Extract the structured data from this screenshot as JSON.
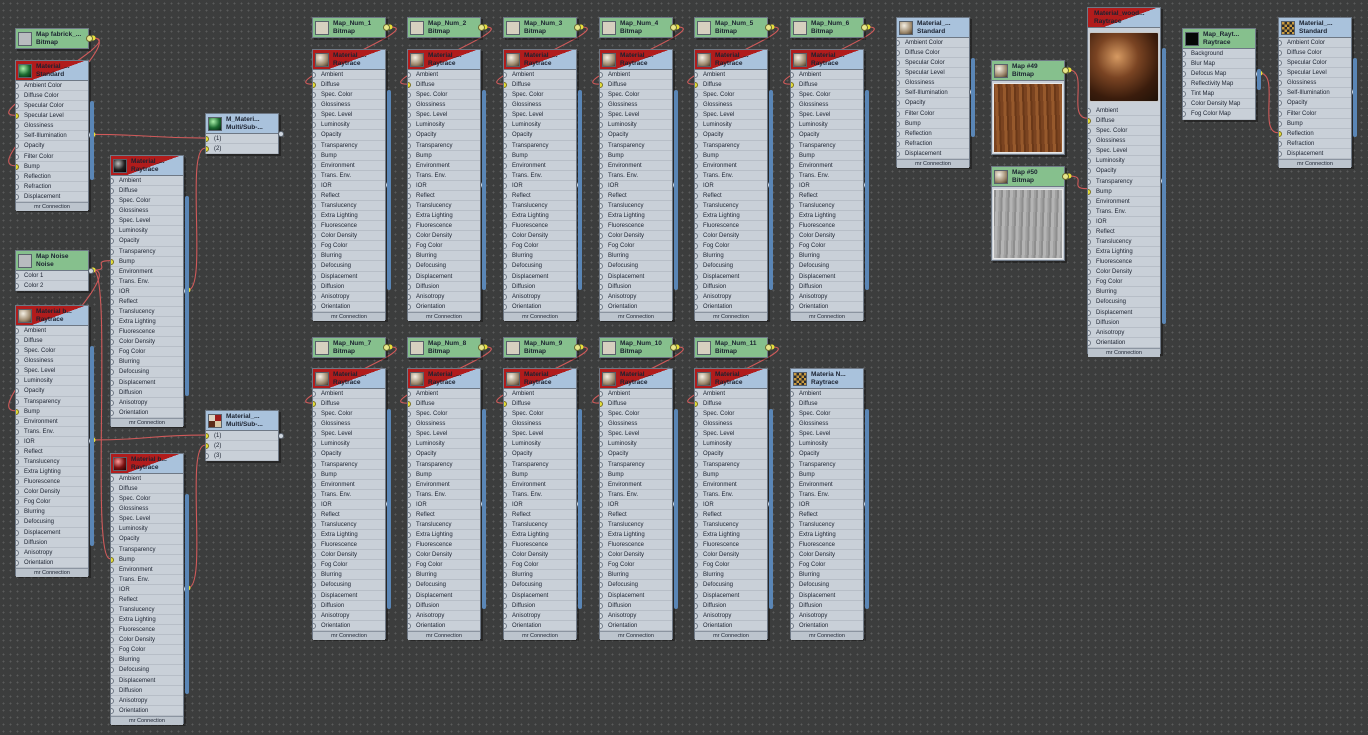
{
  "ui": {
    "footer": "mr Connection"
  },
  "slots_raytrace": [
    "Ambient",
    "Diffuse",
    "Spec. Color",
    "Glossiness",
    "Spec. Level",
    "Luminosity",
    "Opacity",
    "Transparency",
    "Bump",
    "Environment",
    "Trans. Env.",
    "IOR",
    "Reflect",
    "Translucency",
    "Extra Lighting",
    "Fluorescence",
    "Color Density",
    "Fog Color",
    "Blurring",
    "Defocusing",
    "Displacement",
    "Diffusion",
    "Anisotropy",
    "Orientation"
  ],
  "slots_standard": [
    "Ambient Color",
    "Diffuse Color",
    "Specular Color",
    "Specular Level",
    "Glossiness",
    "Self-Illumination",
    "Opacity",
    "Filter Color",
    "Bump",
    "Reflection",
    "Refraction",
    "Displacement"
  ],
  "slots_reflmap": [
    "Background",
    "Blur Map",
    "Defocus Map",
    "Reflectivity Map",
    "Tint Map",
    "Color Density Map",
    "Fog Color Map"
  ],
  "slots_noise": [
    "Color 1",
    "Color 2"
  ],
  "slots_multi2": [
    "(1)",
    "(2)"
  ],
  "slots_multi3": [
    "(1)",
    "(2)",
    "(3)"
  ],
  "nodes": [
    {
      "id": "map_fabrick",
      "title": "Map fabrick_...",
      "subtitle": "Bitmap",
      "kind": "map",
      "thumb": "grey"
    },
    {
      "id": "mat_std_1",
      "title": "Material_...",
      "subtitle": "Standard",
      "kind": "mat",
      "thumb": "green",
      "slots": "standard",
      "selected": true
    },
    {
      "id": "map_noise",
      "title": "Map Noise",
      "subtitle": "Noise",
      "kind": "map",
      "thumb": "grey",
      "slots": "noise"
    },
    {
      "id": "mat_b1",
      "title": "Material b...",
      "subtitle": "Raytrace",
      "kind": "mat",
      "thumb": "sphere",
      "slots": "raytrace",
      "selected": true
    },
    {
      "id": "mat_rt_dark",
      "title": "Material_...",
      "subtitle": "Raytrace",
      "kind": "mat",
      "thumb": "dark",
      "slots": "raytrace",
      "selected": true
    },
    {
      "id": "mat_b2",
      "title": "Material b...",
      "subtitle": "Raytrace",
      "kind": "mat",
      "thumb": "red",
      "slots": "raytrace",
      "selected": true
    },
    {
      "id": "multi_1",
      "title": "M_Materi...",
      "subtitle": "Multi/Sub-...",
      "kind": "mat",
      "thumb": "green",
      "slots": "multi2"
    },
    {
      "id": "multi_2",
      "title": "Material_...",
      "subtitle": "Multi/Sub-...",
      "kind": "mat",
      "thumb": "multi",
      "slots": "multi3"
    },
    {
      "id": "map_num_1",
      "title": "Map_Num_1",
      "subtitle": "Bitmap",
      "kind": "map",
      "thumb": "flat"
    },
    {
      "id": "map_num_2",
      "title": "Map_Num_2",
      "subtitle": "Bitmap",
      "kind": "map",
      "thumb": "flat"
    },
    {
      "id": "map_num_3",
      "title": "Map_Num_3",
      "subtitle": "Bitmap",
      "kind": "map",
      "thumb": "flat"
    },
    {
      "id": "map_num_4",
      "title": "Map_Num_4",
      "subtitle": "Bitmap",
      "kind": "map",
      "thumb": "flat"
    },
    {
      "id": "map_num_5",
      "title": "Map_Num_5",
      "subtitle": "Bitmap",
      "kind": "map",
      "thumb": "flat"
    },
    {
      "id": "map_num_6",
      "title": "Map_Num_6",
      "subtitle": "Bitmap",
      "kind": "map",
      "thumb": "flat"
    },
    {
      "id": "map_num_7",
      "title": "Map_Num_7",
      "subtitle": "Bitmap",
      "kind": "map",
      "thumb": "flat"
    },
    {
      "id": "map_num_8",
      "title": "Map_Num_8",
      "subtitle": "Bitmap",
      "kind": "map",
      "thumb": "flat"
    },
    {
      "id": "map_num_9",
      "title": "Map_Num_9",
      "subtitle": "Bitmap",
      "kind": "map",
      "thumb": "flat"
    },
    {
      "id": "map_num_10",
      "title": "Map_Num_10",
      "subtitle": "Bitmap",
      "kind": "map",
      "thumb": "flat"
    },
    {
      "id": "map_num_11",
      "title": "Map_Num_11",
      "subtitle": "Bitmap",
      "kind": "map",
      "thumb": "flat"
    },
    {
      "id": "rt_1",
      "title": "Material_...",
      "subtitle": "Raytrace",
      "kind": "mat",
      "thumb": "sphere",
      "slots": "raytrace",
      "selected": true
    },
    {
      "id": "rt_2",
      "title": "Material_...",
      "subtitle": "Raytrace",
      "kind": "mat",
      "thumb": "sphere",
      "slots": "raytrace",
      "selected": true
    },
    {
      "id": "rt_3",
      "title": "Material_...",
      "subtitle": "Raytrace",
      "kind": "mat",
      "thumb": "sphere",
      "slots": "raytrace",
      "selected": true
    },
    {
      "id": "rt_4",
      "title": "Material_...",
      "subtitle": "Raytrace",
      "kind": "mat",
      "thumb": "sphere",
      "slots": "raytrace",
      "selected": true
    },
    {
      "id": "rt_5",
      "title": "Material_...",
      "subtitle": "Raytrace",
      "kind": "mat",
      "thumb": "sphere",
      "slots": "raytrace",
      "selected": true
    },
    {
      "id": "rt_6",
      "title": "Material_...",
      "subtitle": "Raytrace",
      "kind": "mat",
      "thumb": "sphere",
      "slots": "raytrace",
      "selected": true
    },
    {
      "id": "rt_7",
      "title": "Material_...",
      "subtitle": "Raytrace",
      "kind": "mat",
      "thumb": "sphere",
      "slots": "raytrace",
      "selected": true
    },
    {
      "id": "rt_8",
      "title": "Material_...",
      "subtitle": "Raytrace",
      "kind": "mat",
      "thumb": "sphere",
      "slots": "raytrace",
      "selected": true
    },
    {
      "id": "rt_9",
      "title": "Material_...",
      "subtitle": "Raytrace",
      "kind": "mat",
      "thumb": "sphere",
      "slots": "raytrace",
      "selected": true
    },
    {
      "id": "rt_10",
      "title": "Material_...",
      "subtitle": "Raytrace",
      "kind": "mat",
      "thumb": "sphere",
      "slots": "raytrace",
      "selected": true
    },
    {
      "id": "rt_11",
      "title": "Material_...",
      "subtitle": "Raytrace",
      "kind": "mat",
      "thumb": "sphere",
      "slots": "raytrace",
      "selected": true
    },
    {
      "id": "rt_n",
      "title": "Materia N...",
      "subtitle": "Raytrace",
      "kind": "mat",
      "thumb": "checker",
      "slots": "raytrace"
    },
    {
      "id": "mat_std_2",
      "title": "Material_...",
      "subtitle": "Standard",
      "kind": "mat",
      "thumb": "sphere",
      "slots": "standard"
    },
    {
      "id": "map_49",
      "title": "Map #49",
      "subtitle": "Bitmap",
      "kind": "map",
      "image": "wood"
    },
    {
      "id": "map_50",
      "title": "Map #50",
      "subtitle": "Bitmap",
      "kind": "map",
      "image": "greywood"
    },
    {
      "id": "mat_wood",
      "title": "Material_wood...",
      "subtitle": "Raytrace",
      "kind": "mat",
      "image": "sphere",
      "slots": "raytrace",
      "selected": true
    },
    {
      "id": "map_raytrace",
      "title": "Map_Rayt...",
      "subtitle": "Raytrace",
      "kind": "map",
      "thumb": "black",
      "slots": "reflmap"
    },
    {
      "id": "mat_std_3",
      "title": "Material_...",
      "subtitle": "Standard",
      "kind": "mat",
      "thumb": "checker",
      "slots": "standard"
    }
  ],
  "connections": [
    {
      "from": "map_fabrick",
      "to": "mat_std_1",
      "slot": "Specular Level"
    },
    {
      "from": "map_fabrick",
      "to": "mat_std_1",
      "slot": "Bump"
    },
    {
      "from": "mat_std_1",
      "to": "multi_1",
      "slot": "(1)"
    },
    {
      "from": "mat_rt_dark",
      "to": "multi_1",
      "slot": "(2)"
    },
    {
      "from": "map_noise",
      "to": "mat_b1",
      "slot": "Bump"
    },
    {
      "from": "map_noise",
      "to": "mat_rt_dark",
      "slot": "Bump"
    },
    {
      "from": "mat_b1",
      "to": "multi_2",
      "slot": "(1)"
    },
    {
      "from": "map_noise",
      "to": "mat_b2",
      "slot": "Bump"
    },
    {
      "from": "mat_b2",
      "to": "multi_2",
      "slot": "(2)"
    },
    {
      "from": "map_num_1",
      "to": "rt_1",
      "slot": "Diffuse"
    },
    {
      "from": "map_num_2",
      "to": "rt_2",
      "slot": "Diffuse"
    },
    {
      "from": "map_num_3",
      "to": "rt_3",
      "slot": "Diffuse"
    },
    {
      "from": "map_num_4",
      "to": "rt_4",
      "slot": "Diffuse"
    },
    {
      "from": "map_num_5",
      "to": "rt_5",
      "slot": "Diffuse"
    },
    {
      "from": "map_num_6",
      "to": "rt_6",
      "slot": "Diffuse"
    },
    {
      "from": "map_num_7",
      "to": "rt_7",
      "slot": "Diffuse"
    },
    {
      "from": "map_num_8",
      "to": "rt_8",
      "slot": "Diffuse"
    },
    {
      "from": "map_num_9",
      "to": "rt_9",
      "slot": "Diffuse"
    },
    {
      "from": "map_num_10",
      "to": "rt_10",
      "slot": "Diffuse"
    },
    {
      "from": "map_num_11",
      "to": "rt_11",
      "slot": "Diffuse"
    },
    {
      "from": "map_49",
      "to": "mat_wood",
      "slot": "Diffuse"
    },
    {
      "from": "map_50",
      "to": "mat_wood",
      "slot": "Bump"
    },
    {
      "from": "map_raytrace",
      "to": "mat_std_3",
      "slot": "Reflection"
    }
  ],
  "colors": {
    "canvas": "#3c3d3d",
    "material_header": "#a9c2dc",
    "map_header": "#86c08d",
    "selected_header": "#b11c1c",
    "wire": "#d05a5a",
    "active_socket": "#e6e03a"
  }
}
